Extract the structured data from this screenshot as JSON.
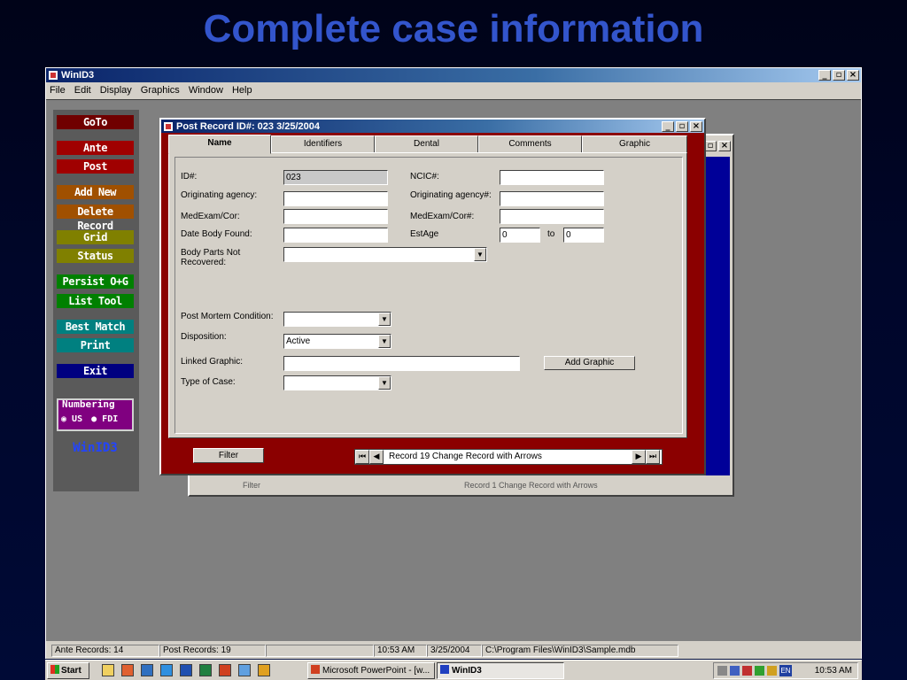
{
  "slide_title": "Complete case information",
  "app": {
    "title": "WinID3",
    "menu": [
      "File",
      "Edit",
      "Display",
      "Graphics",
      "Window",
      "Help"
    ]
  },
  "left_panel": {
    "buttons": [
      {
        "label": "GoTo",
        "bg": "#700000",
        "fg": "#ffffff"
      },
      {
        "label": "Ante",
        "bg": "#a00000",
        "fg": "#ffffff"
      },
      {
        "label": "Post",
        "bg": "#a00000",
        "fg": "#ffffff"
      },
      {
        "label": "Add New",
        "bg": "#a05000",
        "fg": "#ffffff"
      },
      {
        "label": "Delete Record",
        "bg": "#a05000",
        "fg": "#ffffff"
      },
      {
        "label": "Grid",
        "bg": "#808000",
        "fg": "#ffffff"
      },
      {
        "label": "Status",
        "bg": "#808000",
        "fg": "#ffffff"
      },
      {
        "label": "Persist O+G",
        "bg": "#008000",
        "fg": "#ffffff"
      },
      {
        "label": "List Tool",
        "bg": "#008000",
        "fg": "#ffffff"
      },
      {
        "label": "Best Match",
        "bg": "#008080",
        "fg": "#ffffff"
      },
      {
        "label": "Print",
        "bg": "#008080",
        "fg": "#ffffff"
      },
      {
        "label": "Exit",
        "bg": "#000080",
        "fg": "#ffffff"
      }
    ],
    "numbering": {
      "label": "Numbering",
      "options": [
        "US",
        "FDI"
      ],
      "selected": "US"
    },
    "brand": "WinID3"
  },
  "dialog": {
    "title": "Post  Record ID#: 023  3/25/2004",
    "tabs": [
      "Name",
      "Identifiers",
      "Dental",
      "Comments",
      "Graphic"
    ],
    "active_tab": "Name",
    "fields": {
      "id_label": "ID#:",
      "id_value": "023",
      "ncic_label": "NCIC#:",
      "ncic_value": "",
      "orig_agency_label": "Originating agency:",
      "orig_agency_value": "",
      "orig_agency_num_label": "Originating agency#:",
      "orig_agency_num_value": "",
      "medexam_label": "MedExam/Cor:",
      "medexam_value": "",
      "medexam_num_label": "MedExam/Cor#:",
      "medexam_num_value": "",
      "date_found_label": "Date Body Found:",
      "date_found_value": "",
      "estage_label": "EstAge",
      "estage_from": "0",
      "estage_to_label": "to",
      "estage_to": "0",
      "body_parts_label": "Body Parts Not Recovered:",
      "body_parts_value": "",
      "postmortem_label": "Post Mortem Condition:",
      "postmortem_value": "",
      "disposition_label": "Disposition:",
      "disposition_value": "Active",
      "linked_graphic_label": "Linked Graphic:",
      "linked_graphic_value": "",
      "add_graphic_button": "Add Graphic",
      "type_case_label": "Type of Case:",
      "type_case_value": ""
    },
    "filter_button": "Filter",
    "record_nav": "Record 19   Change Record with Arrows"
  },
  "back_dialog": {
    "filter_button": "Filter",
    "record_nav": "Record 1   Change Record with Arrows"
  },
  "status_bar": {
    "ante": "Ante Records: 14",
    "post": "Post Records: 19",
    "time": "10:53 AM",
    "date": "3/25/2004",
    "path": "C:\\Program Files\\WinID3\\Sample.mdb"
  },
  "taskbar": {
    "start": "Start",
    "items": [
      "Microsoft PowerPoint - [w...",
      "WinID3"
    ],
    "active_item": "WinID3",
    "clock": "10:53 AM",
    "lang": "EN"
  }
}
